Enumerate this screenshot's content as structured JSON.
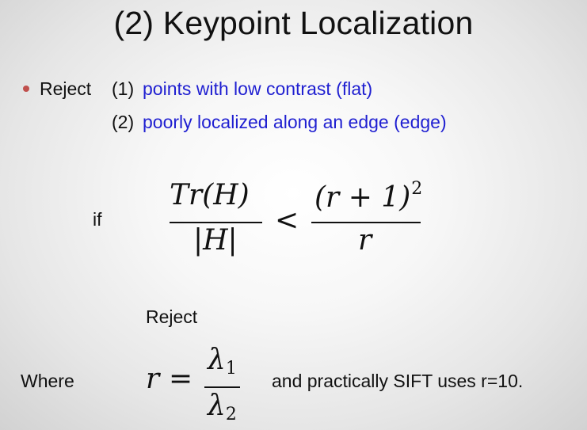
{
  "slide": {
    "title": "(2) Keypoint Localization",
    "bullet": {
      "lead": "Reject",
      "items": [
        {
          "number": "(1)",
          "text": "points with low contrast (flat)"
        },
        {
          "number": "(2)",
          "text": "poorly localized along an edge (edge)"
        }
      ]
    },
    "condition": {
      "if_label": "if",
      "lhs_numerator": "Tr(H)",
      "lhs_denominator": "|H|",
      "operator": "<",
      "rhs_numerator_base": "(r + 1)",
      "rhs_numerator_exponent": "2",
      "rhs_denominator": "r",
      "result_label": "Reject"
    },
    "definition": {
      "where_label": "Where",
      "lhs": "r",
      "equals": "=",
      "numerator": "λ",
      "numerator_sub": "1",
      "denominator": "λ",
      "denominator_sub": "2",
      "note": "and practically SIFT uses r=10."
    },
    "colors": {
      "accent_blue": "#1f1fd1",
      "bullet_red": "#c0504d"
    }
  }
}
